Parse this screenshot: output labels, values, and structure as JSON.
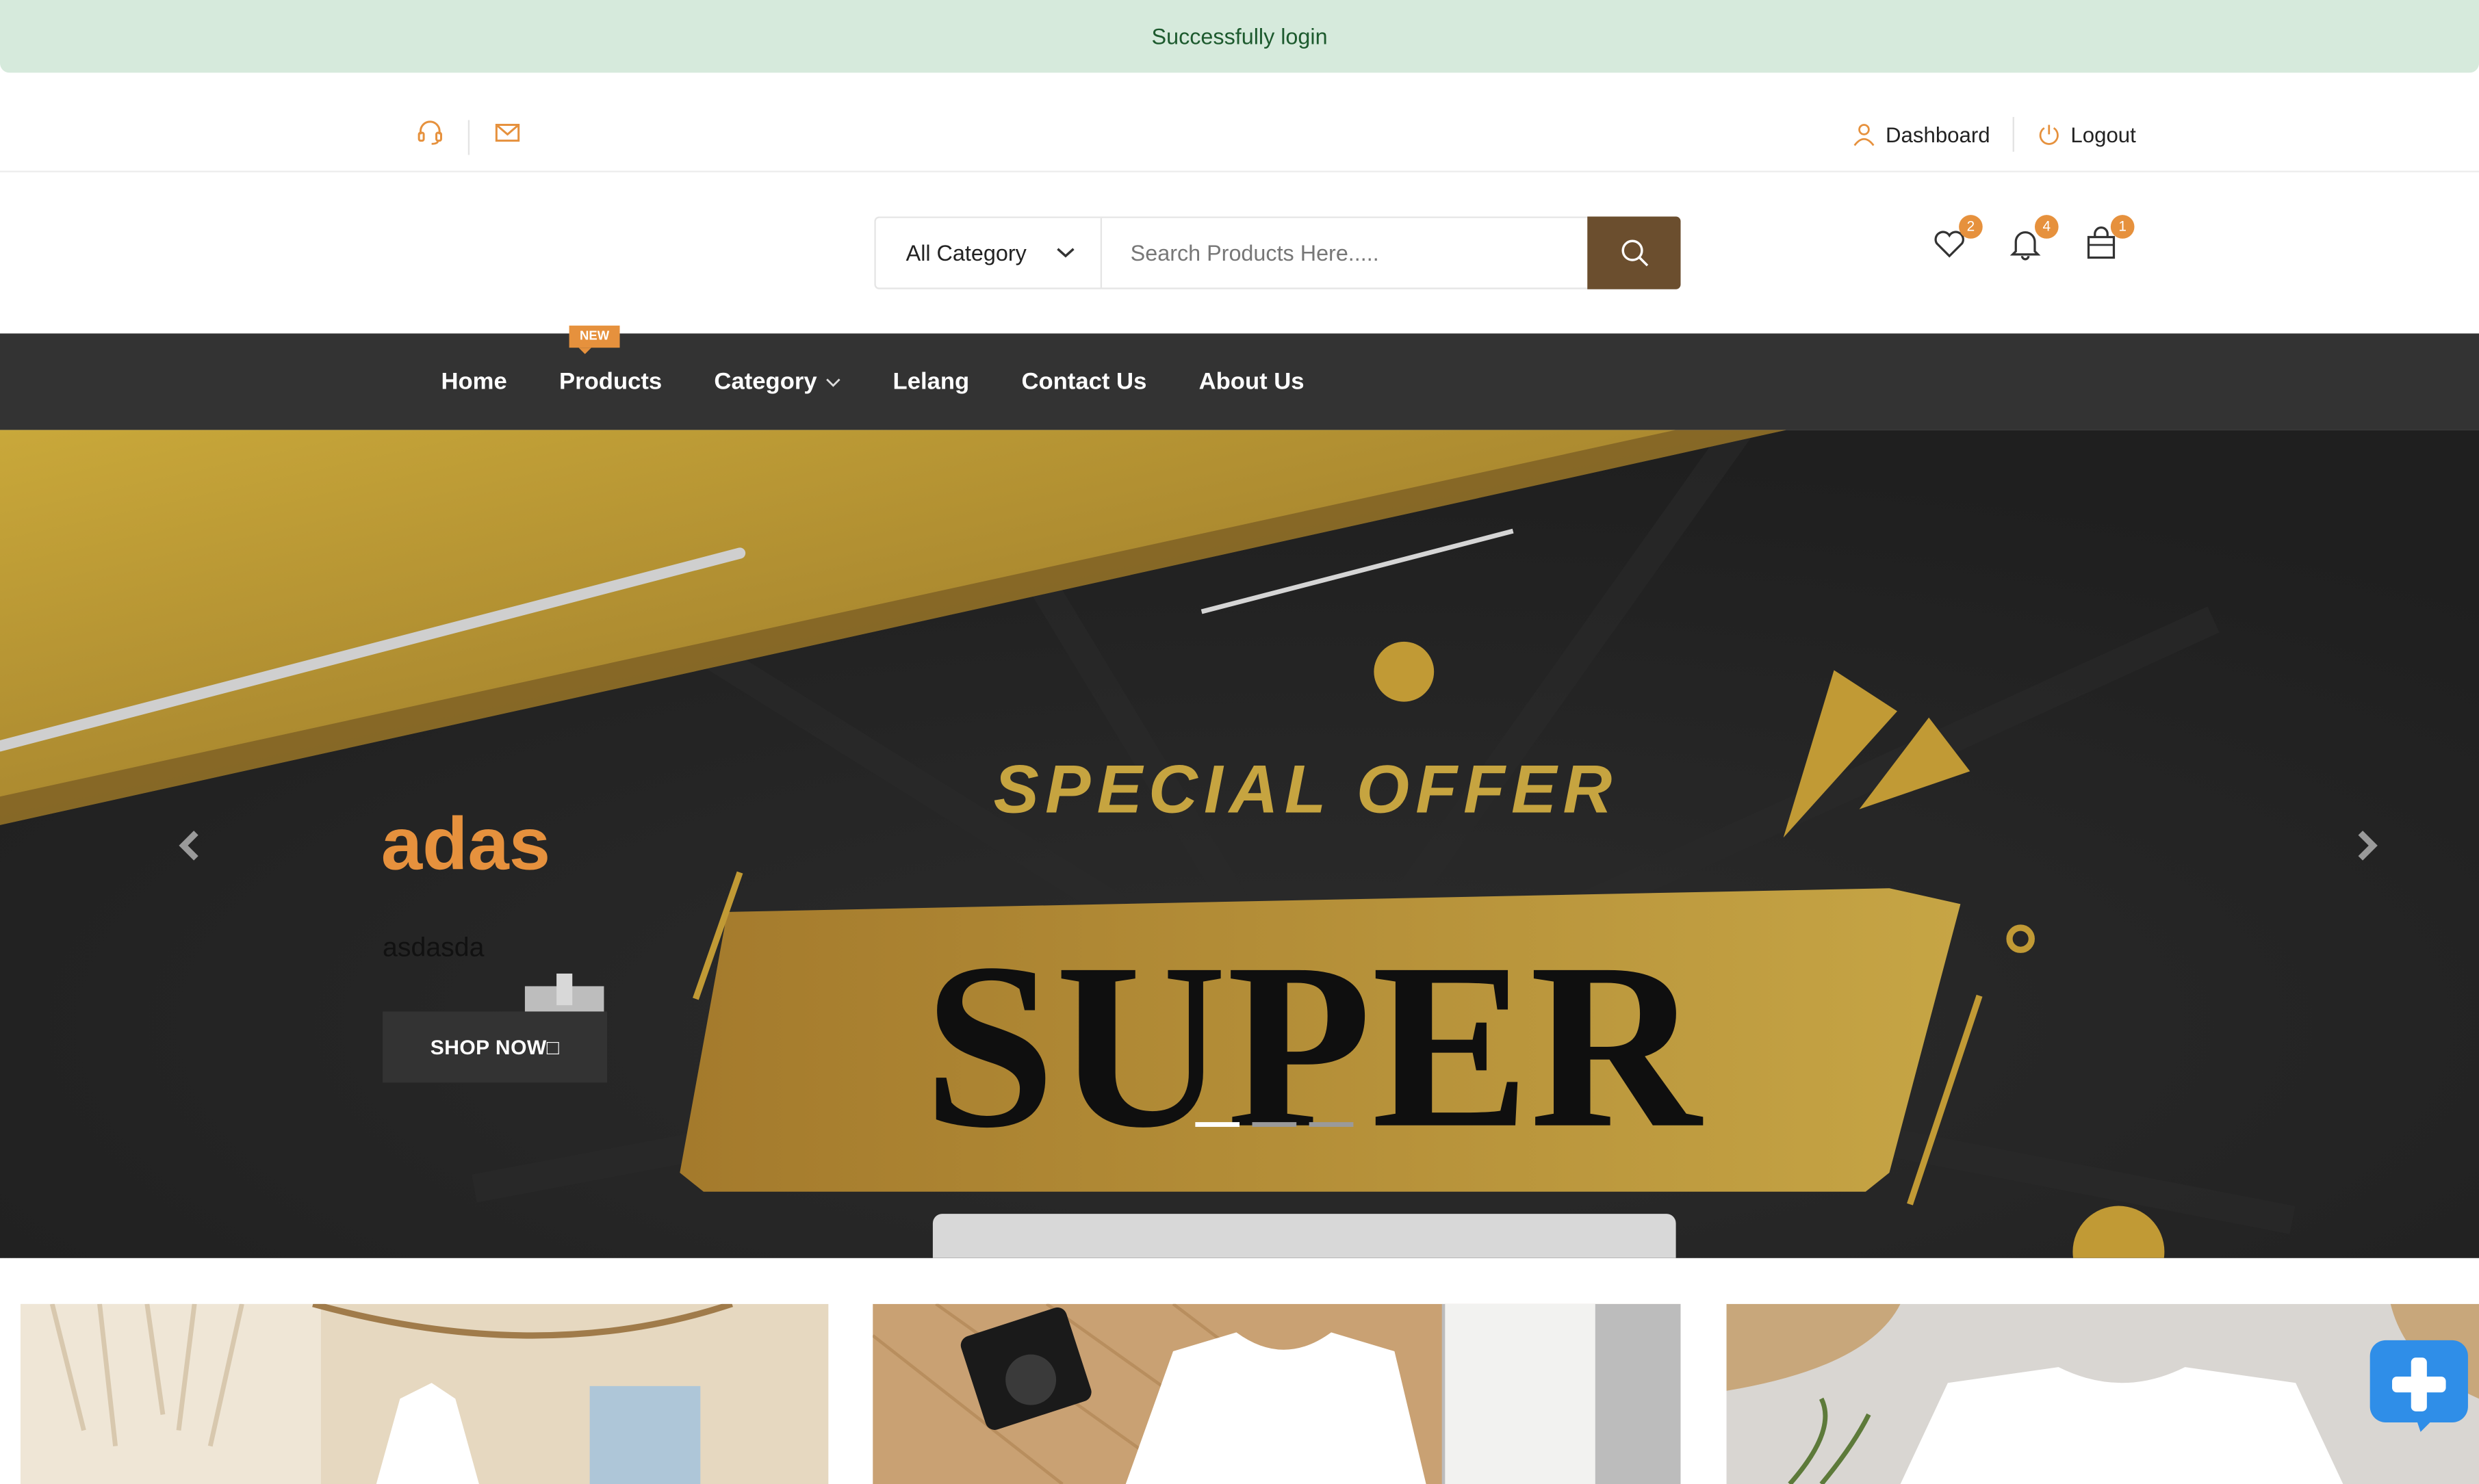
{
  "alert": {
    "message": "Successfully login"
  },
  "topbar": {
    "left_icons": [
      "headset-icon",
      "mail-icon"
    ],
    "dashboard_label": "Dashboard",
    "logout_label": "Logout"
  },
  "search": {
    "category_selected": "All Category",
    "placeholder": "Search Products Here....."
  },
  "header_icons": {
    "wishlist_count": "2",
    "notifications_count": "4",
    "cart_count": "1"
  },
  "nav": {
    "items": [
      {
        "label": "Home"
      },
      {
        "label": "Products",
        "badge": "NEW"
      },
      {
        "label": "Category",
        "has_dropdown": true
      },
      {
        "label": "Lelang"
      },
      {
        "label": "Contact Us"
      },
      {
        "label": "About Us"
      }
    ]
  },
  "hero": {
    "title": "adas",
    "description": "asdasda",
    "button_label": "SHOP NOW□",
    "banner_heading": "SPECIAL OFFER",
    "banner_word": "SUPER",
    "slide_count": 3,
    "active_slide": 1
  },
  "colors": {
    "accent": "#e6913d",
    "nav_bg": "#333333",
    "alert_bg": "#d6eadc",
    "search_button": "#6b4e2e",
    "banner_gold": "#b8962f"
  }
}
